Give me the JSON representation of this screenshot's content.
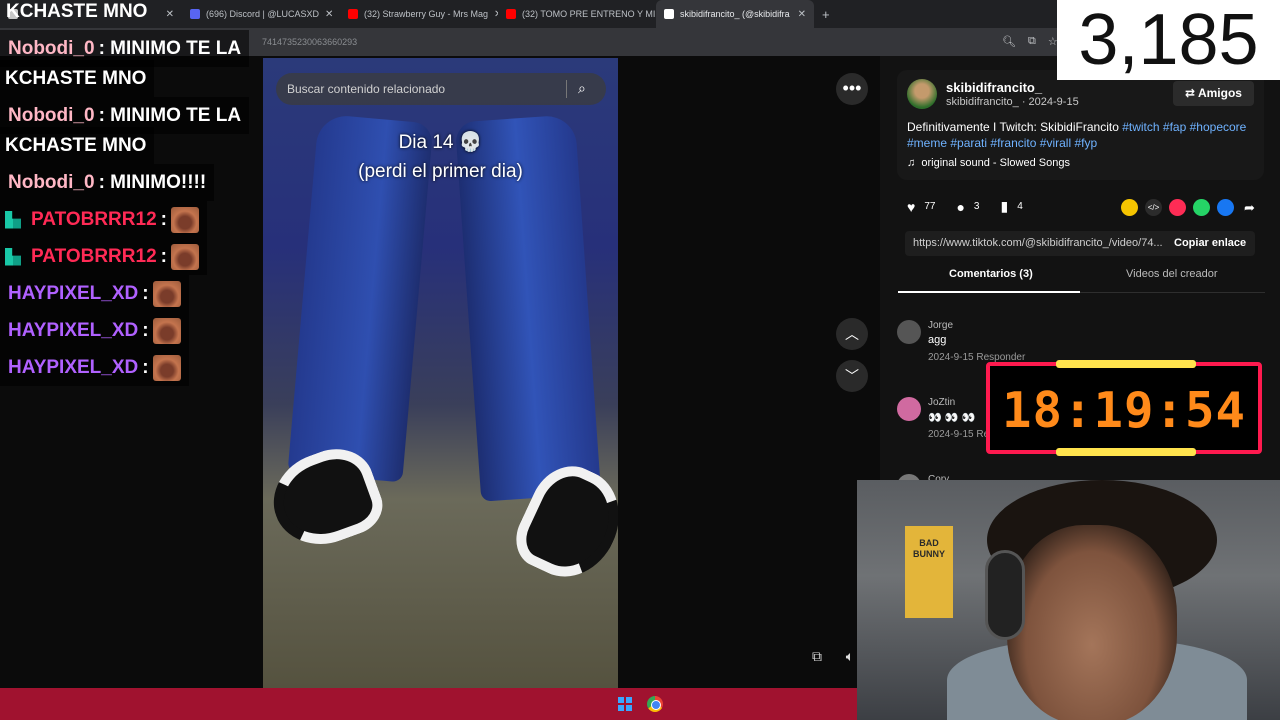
{
  "browser": {
    "tabs": [
      {
        "label": "",
        "color": "#c7c7c7"
      },
      {
        "label": "(696) Discord | @LUCASXD",
        "color": "#5865f2"
      },
      {
        "label": "(32) Strawberry Guy - Mrs Mag",
        "color": "#ff0000"
      },
      {
        "label": "(32) TOMO PRE ENTRENO Y MI",
        "color": "#ff0000"
      },
      {
        "label": "skibidifrancito_ (@skibidifra",
        "color": "#ffffff"
      }
    ],
    "new_tab": "+",
    "url_tail": "7414735230063660293"
  },
  "overlay_title": "KCHASTE MNO",
  "chat": [
    {
      "user": "Nobodi_0",
      "user_color": "#ffb7c5",
      "text": " : MINIMO TE LA"
    },
    {
      "user": "",
      "user_color": "#ffffff",
      "text": "KCHASTE MNO"
    },
    {
      "user": "Nobodi_0",
      "user_color": "#ffb7c5",
      "text": " : MINIMO TE LA"
    },
    {
      "user": "",
      "user_color": "#ffffff",
      "text": "KCHASTE MNO"
    },
    {
      "user": "Nobodi_0",
      "user_color": "#ffb7c5",
      "text": " : MINIMO!!!!"
    },
    {
      "user": "PATOBRRR12",
      "user_color": "#ff2a55",
      "text": " :"
    },
    {
      "user": "PATOBRRR12",
      "user_color": "#ff2a55",
      "text": " :"
    },
    {
      "user": "HAYPIXEL_XD",
      "user_color": "#b061ff",
      "text": " :"
    },
    {
      "user": "HAYPIXEL_XD",
      "user_color": "#b061ff",
      "text": " :"
    },
    {
      "user": "HAYPIXEL_XD",
      "user_color": "#b061ff",
      "text": " :"
    }
  ],
  "video": {
    "search_placeholder": "Buscar contenido relacionado",
    "caption_line1": "Dia 14 💀",
    "caption_line2": "(perdi el primer dia)",
    "more": "•••"
  },
  "post": {
    "username": "skibidifrancito_",
    "handle_date": "skibidifrancito_ · 2024-9-15",
    "friends_label": "Amigos",
    "desc_text": "Definitivamente I Twitch: SkibidiFrancito",
    "tags": [
      "#twitch",
      "#fap",
      "#hopecore",
      "#meme",
      "#parati",
      "#francito",
      "#virall",
      "#fyp"
    ],
    "sound": "original sound - Slowed Songs",
    "likes": "77",
    "comments": "3",
    "saves": "4",
    "link": "https://www.tiktok.com/@skibidifrancito_/video/74...",
    "copy_label": "Copiar enlace",
    "tab_comments": "Comentarios (3)",
    "tab_videos": "Videos del creador"
  },
  "comments": [
    {
      "name": "Jorge",
      "text": "agg",
      "meta": "2024-9-15   Responder"
    },
    {
      "name": "JoZtin",
      "text": "👀 👀 👀",
      "meta": "2024-9-15   Responder"
    },
    {
      "name": "Cory",
      "text": "",
      "meta": ""
    }
  ],
  "timer": "18:19:54",
  "counter": "3,185",
  "webcam": {
    "poster": "BAD BUNNY"
  },
  "colors": {
    "taskbar": "#a0122f",
    "timer_border": "#ff1a4f",
    "timer_text": "#ff8a1a",
    "hashtag": "#6fb2ff"
  }
}
